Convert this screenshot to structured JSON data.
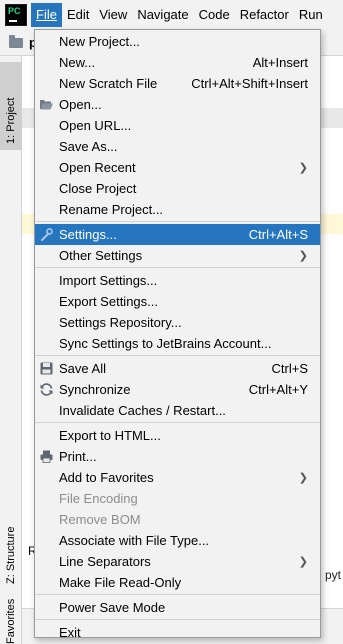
{
  "app": {
    "logo_text": "PC"
  },
  "menubar": {
    "items": [
      {
        "label": "File",
        "active": true
      },
      {
        "label": "Edit"
      },
      {
        "label": "View"
      },
      {
        "label": "Navigate"
      },
      {
        "label": "Code"
      },
      {
        "label": "Refactor"
      },
      {
        "label": "Run"
      }
    ]
  },
  "navbar": {
    "crumb": "p"
  },
  "sidebar": {
    "project_tab": "1: Project",
    "structure_tab": "Z: Structure",
    "favorites_tab": "Favorites"
  },
  "pane": {
    "run_tab": "R",
    "right_text": "pyt"
  },
  "file_menu": {
    "items": [
      {
        "label": "New Project...",
        "shortcut": ""
      },
      {
        "label": "New...",
        "shortcut": "Alt+Insert"
      },
      {
        "label": "New Scratch File",
        "shortcut": "Ctrl+Alt+Shift+Insert"
      },
      {
        "label": "Open...",
        "shortcut": "",
        "icon": "folder-open-icon"
      },
      {
        "label": "Open URL...",
        "shortcut": ""
      },
      {
        "label": "Save As...",
        "shortcut": ""
      },
      {
        "label": "Open Recent",
        "shortcut": "",
        "submenu": true
      },
      {
        "label": "Close Project",
        "shortcut": ""
      },
      {
        "label": "Rename Project...",
        "shortcut": ""
      },
      {
        "label": "Settings...",
        "shortcut": "Ctrl+Alt+S",
        "icon": "wrench-icon",
        "selected": true
      },
      {
        "label": "Other Settings",
        "shortcut": "",
        "submenu": true
      },
      {
        "label": "Import Settings...",
        "shortcut": ""
      },
      {
        "label": "Export Settings...",
        "shortcut": ""
      },
      {
        "label": "Settings Repository...",
        "shortcut": ""
      },
      {
        "label": "Sync Settings to JetBrains Account...",
        "shortcut": ""
      },
      {
        "label": "Save All",
        "shortcut": "Ctrl+S",
        "icon": "save-all-icon"
      },
      {
        "label": "Synchronize",
        "shortcut": "Ctrl+Alt+Y",
        "icon": "synchronize-icon"
      },
      {
        "label": "Invalidate Caches / Restart...",
        "shortcut": ""
      },
      {
        "label": "Export to HTML...",
        "shortcut": ""
      },
      {
        "label": "Print...",
        "shortcut": "",
        "icon": "printer-icon"
      },
      {
        "label": "Add to Favorites",
        "shortcut": "",
        "submenu": true
      },
      {
        "label": "File Encoding",
        "shortcut": "",
        "disabled": true
      },
      {
        "label": "Remove BOM",
        "shortcut": "",
        "disabled": true
      },
      {
        "label": "Associate with File Type...",
        "shortcut": ""
      },
      {
        "label": "Line Separators",
        "shortcut": "",
        "submenu": true
      },
      {
        "label": "Make File Read-Only",
        "shortcut": ""
      },
      {
        "label": "Power Save Mode",
        "shortcut": ""
      },
      {
        "label": "Exit",
        "shortcut": ""
      }
    ]
  },
  "colors": {
    "menu_bg": "#f2f2f2",
    "selection": "#2675bf",
    "disabled_text": "#8c8c8c",
    "separator": "#d1d1d1"
  }
}
